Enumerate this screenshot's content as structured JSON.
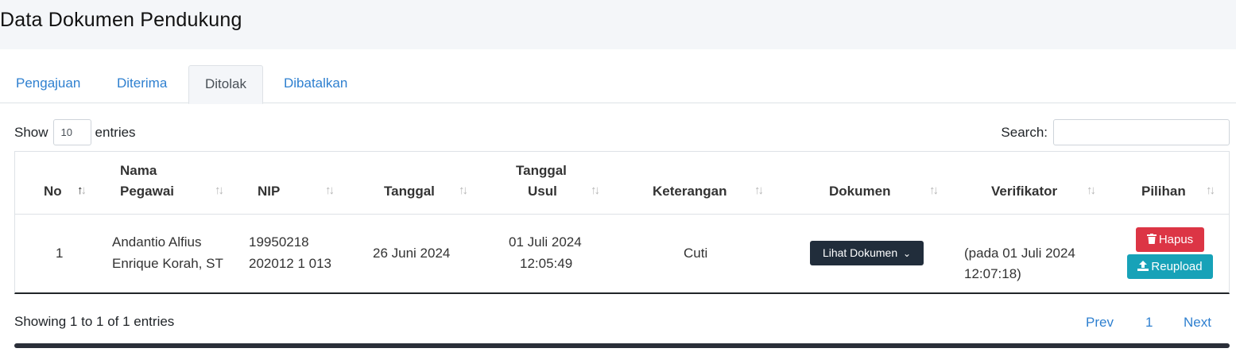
{
  "page": {
    "title": "Data Dokumen Pendukung"
  },
  "tabs": [
    {
      "label": "Pengajuan"
    },
    {
      "label": "Diterima"
    },
    {
      "label": "Ditolak"
    },
    {
      "label": "Dibatalkan"
    }
  ],
  "active_tab": "Ditolak",
  "table_controls": {
    "show_label": "Show",
    "entries_label": "entries",
    "page_length": "10",
    "search_label": "Search:",
    "search_value": ""
  },
  "table": {
    "columns": [
      {
        "label": "No"
      },
      {
        "label_line1": "Nama",
        "label_line2": "Pegawai"
      },
      {
        "label": "NIP"
      },
      {
        "label": "Tanggal"
      },
      {
        "label_line1": "Tanggal",
        "label_line2": "Usul"
      },
      {
        "label": "Keterangan"
      },
      {
        "label": "Dokumen"
      },
      {
        "label": "Verifikator"
      },
      {
        "label": "Pilihan"
      }
    ],
    "sort_icon": "sort-arrows-icon",
    "rows": [
      {
        "no": "1",
        "nama_line1": "Andantio Alfius",
        "nama_line2": "Enrique Korah, ST",
        "nip_line1": "19950218",
        "nip_line2": "202012 1 013",
        "tanggal": "26 Juni 2024",
        "tanggal_usul_line1": "01 Juli 2024",
        "tanggal_usul_line2": "12:05:49",
        "keterangan": "Cuti",
        "dokumen_button": "Lihat Dokumen",
        "verifikator_line1": "(pada 01 Juli 2024",
        "verifikator_line2": "12:07:18)",
        "hapus_button": "Hapus",
        "reupload_button": "Reupload"
      }
    ]
  },
  "footer": {
    "info": "Showing 1 to 1 of 1 entries",
    "prev": "Prev",
    "page": "1",
    "next": "Next"
  },
  "colors": {
    "link": "#2f80d0",
    "danger": "#dc3545",
    "info": "#17a2b8",
    "dark": "#212d3b",
    "header_bg": "#f4f6f9"
  }
}
